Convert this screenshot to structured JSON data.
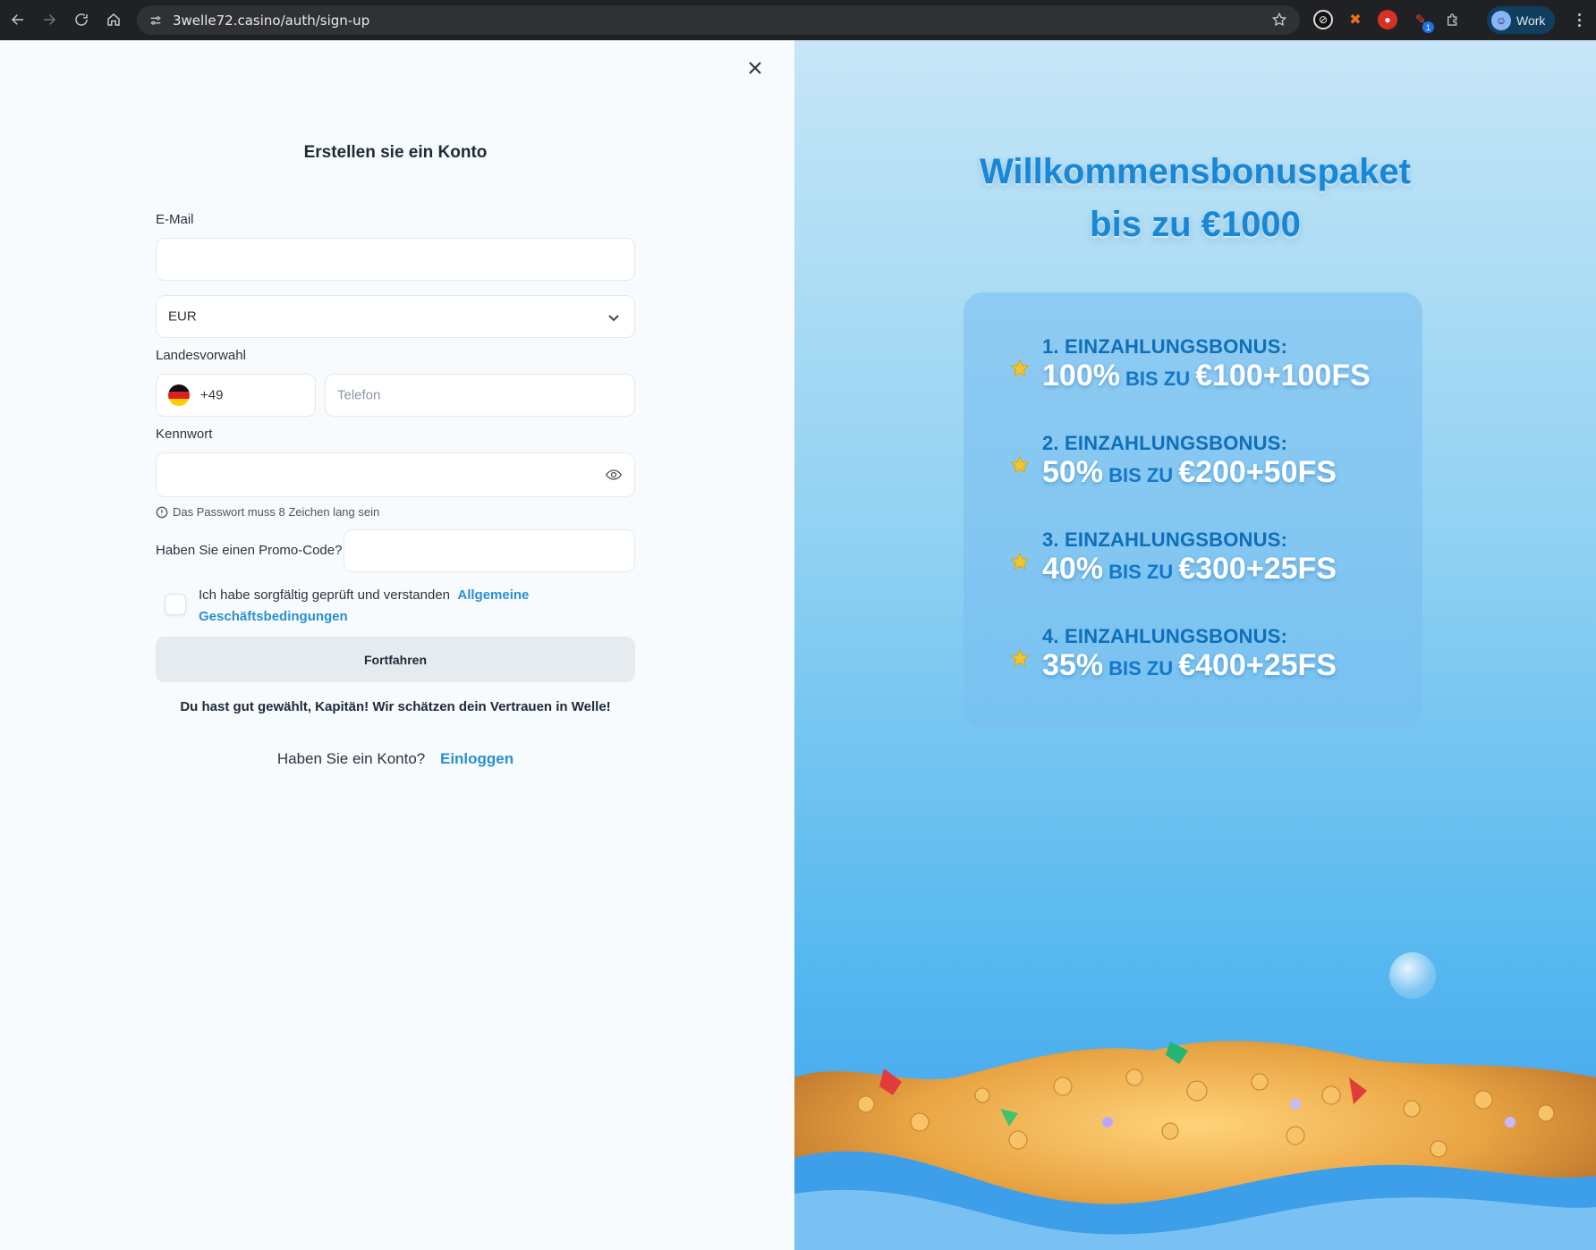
{
  "browser": {
    "url": "3welle72.casino/auth/sign-up",
    "profile_label": "Work",
    "extension_badge": "1"
  },
  "signup": {
    "title": "Erstellen sie ein Konto",
    "email_label": "E-Mail",
    "email_value": "",
    "currency_value": "EUR",
    "country_code_label": "Landesvorwahl",
    "country_code_value": "+49",
    "phone_placeholder": "Telefon",
    "password_label": "Kennwort",
    "password_hint": "Das Passwort muss 8 Zeichen lang sein",
    "promo_label": "Haben Sie einen Promo-Code?",
    "terms_text": "Ich habe sorgfältig geprüft und verstanden",
    "terms_link": "Allgemeine Geschäftsbedingungen",
    "continue_button": "Fortfahren",
    "welcome_text": "Du hast gut gewählt, Kapitän! Wir schätzen dein Vertrauen in Welle!",
    "login_prompt": "Haben Sie ein Konto?",
    "login_link": "Einloggen"
  },
  "bonus": {
    "title_line1": "Willkommensbonuspaket",
    "title_line2": "bis zu €1000",
    "items": [
      {
        "head": "1. EINZAHLUNGSBONUS:",
        "percent": "100%",
        "upto": "BIS ZU",
        "amount": "€100+100FS"
      },
      {
        "head": "2. EINZAHLUNGSBONUS:",
        "percent": "50%",
        "upto": "BIS ZU",
        "amount": "€200+50FS"
      },
      {
        "head": "3. EINZAHLUNGSBONUS:",
        "percent": "40%",
        "upto": "BIS ZU",
        "amount": "€300+25FS"
      },
      {
        "head": "4. EINZAHLUNGSBONUS:",
        "percent": "35%",
        "upto": "BIS ZU",
        "amount": "€400+25FS"
      }
    ]
  },
  "colors": {
    "accent_link": "#2a8fd3",
    "bonus_title": "#1787d6",
    "chrome_bg": "#202124"
  }
}
